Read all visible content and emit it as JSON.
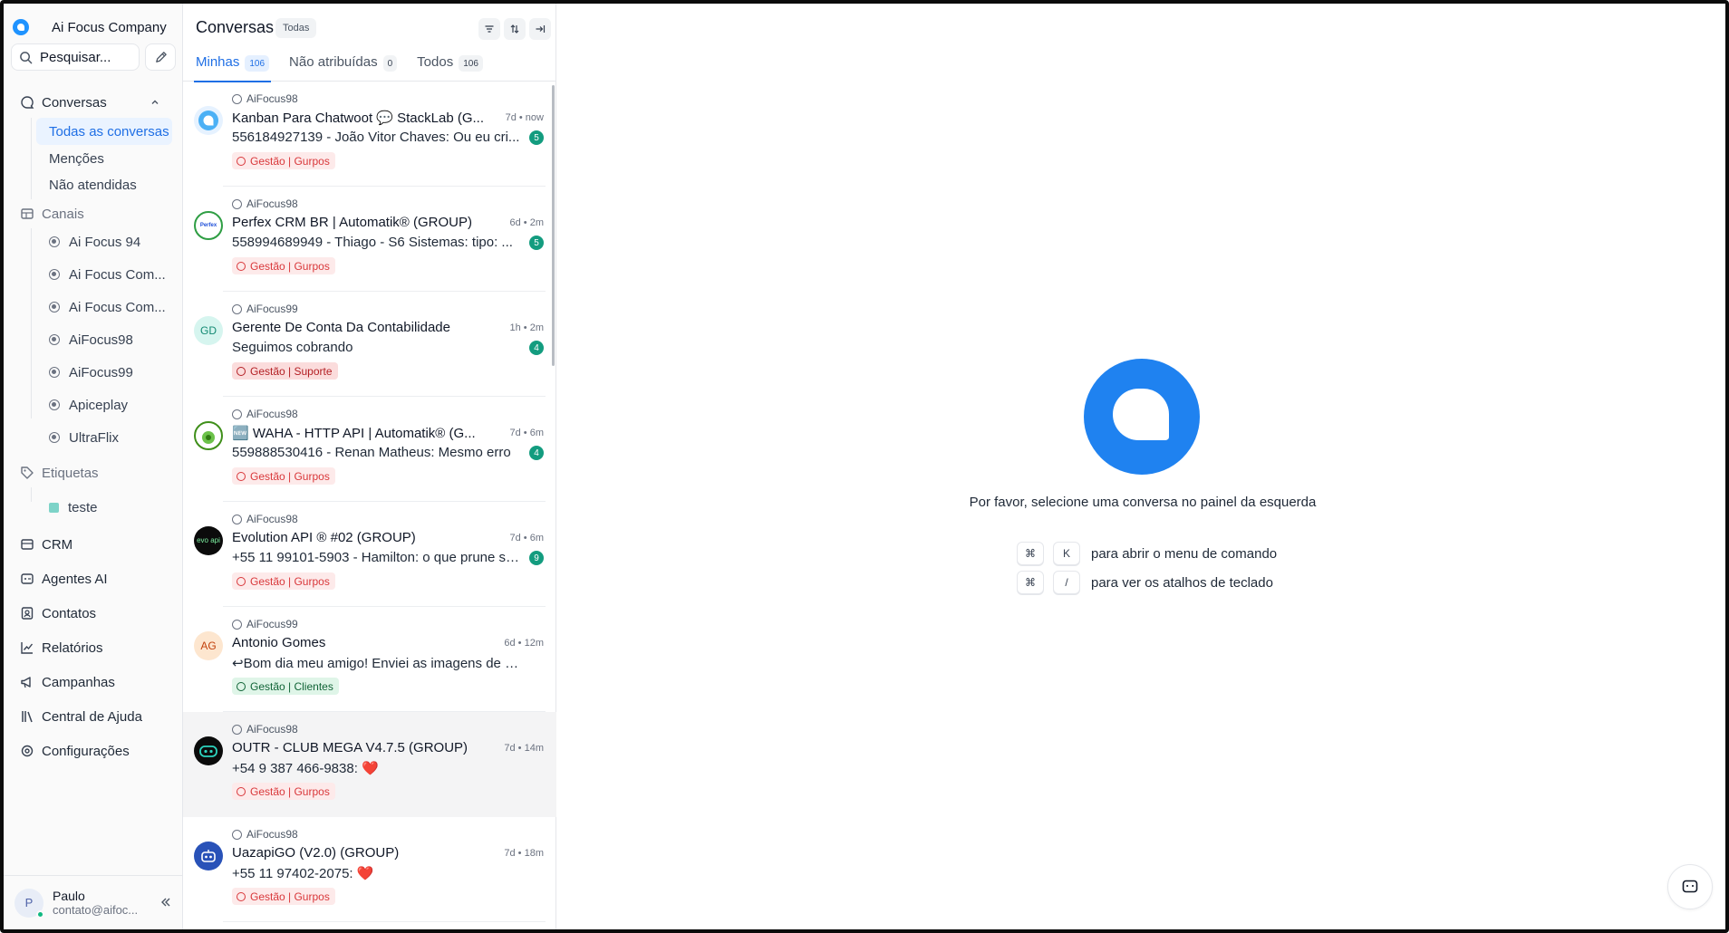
{
  "brand": {
    "name": "Ai Focus Company"
  },
  "search": {
    "placeholder": "Pesquisar..."
  },
  "nav": {
    "conversations": "Conversas",
    "all_conversations": "Todas as conversas",
    "mentions": "Menções",
    "unattended": "Não atendidas",
    "channels": "Canais",
    "channel_items": [
      "Ai Focus 94",
      "Ai Focus Com...",
      "Ai Focus Com...",
      "AiFocus98",
      "AiFocus99",
      "Apiceplay",
      "UltraFlix"
    ],
    "labels": "Etiquetas",
    "label_items": [
      "teste"
    ],
    "crm": "CRM",
    "ai_agents": "Agentes AI",
    "contacts": "Contatos",
    "reports": "Relatórios",
    "campaigns": "Campanhas",
    "help_center": "Central de Ajuda",
    "settings": "Configurações"
  },
  "user": {
    "name": "Paulo",
    "email": "contato@aifoc...",
    "initial": "P"
  },
  "conversations_panel": {
    "title": "Conversas",
    "filter_pill": "Todas",
    "tabs": [
      {
        "label": "Minhas",
        "count": "106"
      },
      {
        "label": "Não atribuídas",
        "count": "0"
      },
      {
        "label": "Todos",
        "count": "106"
      }
    ],
    "items": [
      {
        "inbox": "AiFocus98",
        "name": "Kanban Para Chatwoot 💬 StackLab (G...",
        "time": "7d • now",
        "message": "556184927139 - João Vitor Chaves: Ou eu cri...",
        "unread": "5",
        "tag": "Gestão | Gurpos",
        "tag_style": "red",
        "avatar": "chatwoot"
      },
      {
        "inbox": "AiFocus98",
        "name": "Perfex CRM BR | Automatik® (GROUP)",
        "time": "6d • 2m",
        "message": "558994689949 - Thiago - S6 Sistemas: tipo: ...",
        "unread": "5",
        "tag": "Gestão | Gurpos",
        "tag_style": "red",
        "avatar": "Perfex"
      },
      {
        "inbox": "AiFocus99",
        "name": "Gerente De Conta Da Contabilidade",
        "time": "1h • 2m",
        "message": "Seguimos cobrando",
        "unread": "4",
        "tag": "Gestão | Suporte",
        "tag_style": "red-strong",
        "avatar": "GD"
      },
      {
        "inbox": "AiFocus98",
        "name": "🆕 WAHA - HTTP API | Automatik® (G...",
        "time": "7d • 6m",
        "message": "559888530416 - Renan Matheus: Mesmo erro",
        "unread": "4",
        "tag": "Gestão | Gurpos",
        "tag_style": "red",
        "avatar": "waha"
      },
      {
        "inbox": "AiFocus98",
        "name": "Evolution API ® #02 (GROUP)",
        "time": "7d • 6m",
        "message": "+55 11 99101-5903 - Hamilton: o que prune se...",
        "unread": "9",
        "tag": "Gestão | Gurpos",
        "tag_style": "red",
        "avatar": "evo api"
      },
      {
        "inbox": "AiFocus99",
        "name": "Antonio Gomes",
        "time": "6d • 12m",
        "message": "↩Bom dia meu amigo! Enviei as imagens de onte...",
        "unread": "",
        "tag": "Gestão | Clientes",
        "tag_style": "green",
        "avatar": "AG"
      },
      {
        "inbox": "AiFocus98",
        "name": "OUTR - CLUB MEGA V4.7.5 (GROUP)",
        "time": "7d • 14m",
        "message": "+54 9 387 466-9838: ❤️",
        "unread": "",
        "tag": "Gestão | Gurpos",
        "tag_style": "red",
        "avatar": "robot"
      },
      {
        "inbox": "AiFocus98",
        "name": "UazapiGO (V2.0) (GROUP)",
        "time": "7d • 18m",
        "message": "+55 11 97402-2075: ❤️",
        "unread": "",
        "tag": "Gestão | Gurpos",
        "tag_style": "red",
        "avatar": "uazapi"
      }
    ]
  },
  "empty_state": {
    "message": "Por favor, selecione uma conversa no painel da esquerda",
    "shortcuts": [
      {
        "keys": [
          "⌘",
          "K"
        ],
        "description": "para abrir o menu de comando"
      },
      {
        "keys": [
          "⌘",
          "/"
        ],
        "description": "para ver os atalhos de teclado"
      }
    ]
  },
  "colors": {
    "accent": "#1f6fe5",
    "brand": "#1f93ff",
    "unread_badge": "#139c7f"
  }
}
